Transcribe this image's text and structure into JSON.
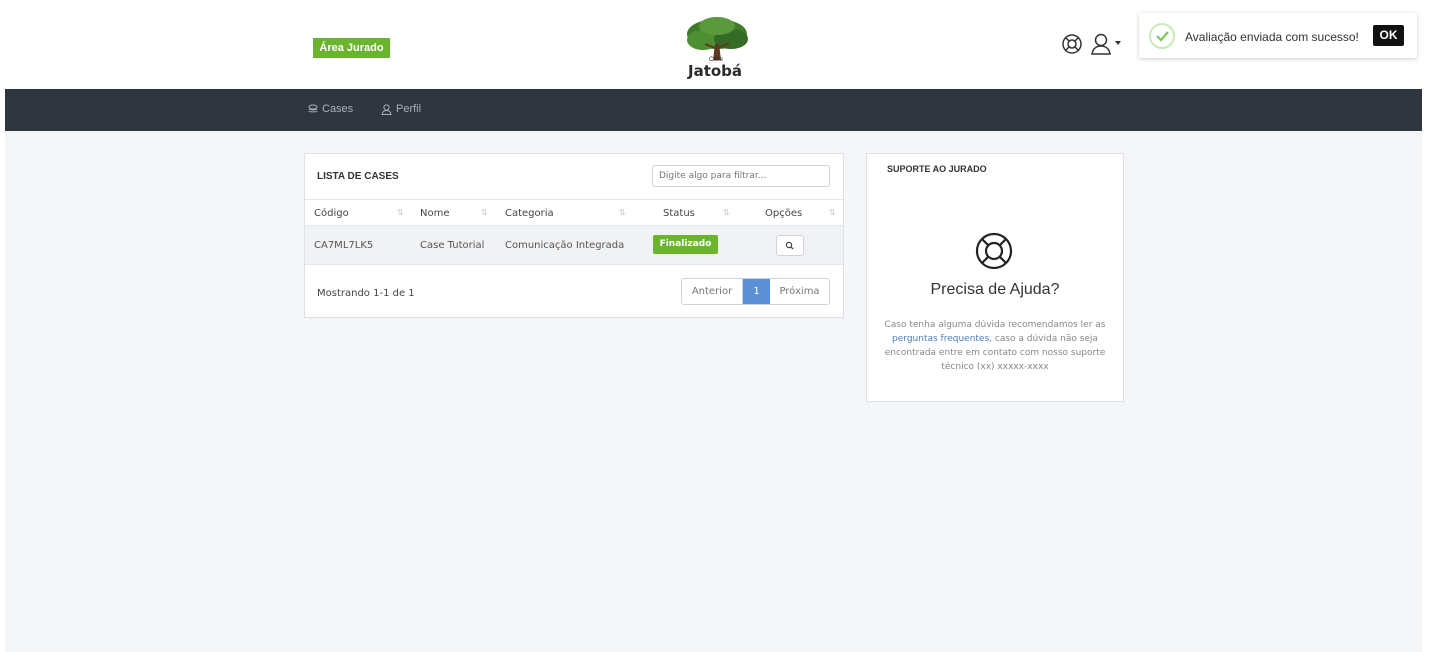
{
  "header": {
    "area_badge": "Área Jurado",
    "logo_name": "Jatobá",
    "logo_small": "Case"
  },
  "toast": {
    "message": "Avaliação enviada com sucesso!",
    "ok_label": "OK"
  },
  "nav": {
    "items": [
      {
        "label": "Cases",
        "icon": "layers-icon"
      },
      {
        "label": "Perfil",
        "icon": "user-icon"
      }
    ]
  },
  "cases": {
    "title": "LISTA DE CASES",
    "filter_placeholder": "Digite algo para filtrar...",
    "columns": [
      "Código",
      "Nome",
      "Categoria",
      "Status",
      "Opções"
    ],
    "rows": [
      {
        "codigo": "CA7ML7LK5",
        "nome": "Case Tutorial",
        "categoria": "Comunicação Integrada",
        "status": "Finalizado"
      }
    ],
    "footer": "Mostrando 1-1 de 1",
    "pagination": {
      "prev": "Anterior",
      "current": "1",
      "next": "Próxima"
    }
  },
  "support": {
    "title": "SUPORTE AO JURADO",
    "heading": "Precisa de Ajuda?",
    "text_before": "Caso tenha alguma dúvida recomendamos ler as ",
    "link": "perguntas frequentes",
    "text_after": ", caso a dúvida não seja encontrada entre em contato com nosso suporte técnico (xx) xxxxx-xxxx"
  },
  "colors": {
    "accent_green": "#6bb52e",
    "navbar": "#2f3640",
    "pagination_active": "#5b8fd6"
  }
}
